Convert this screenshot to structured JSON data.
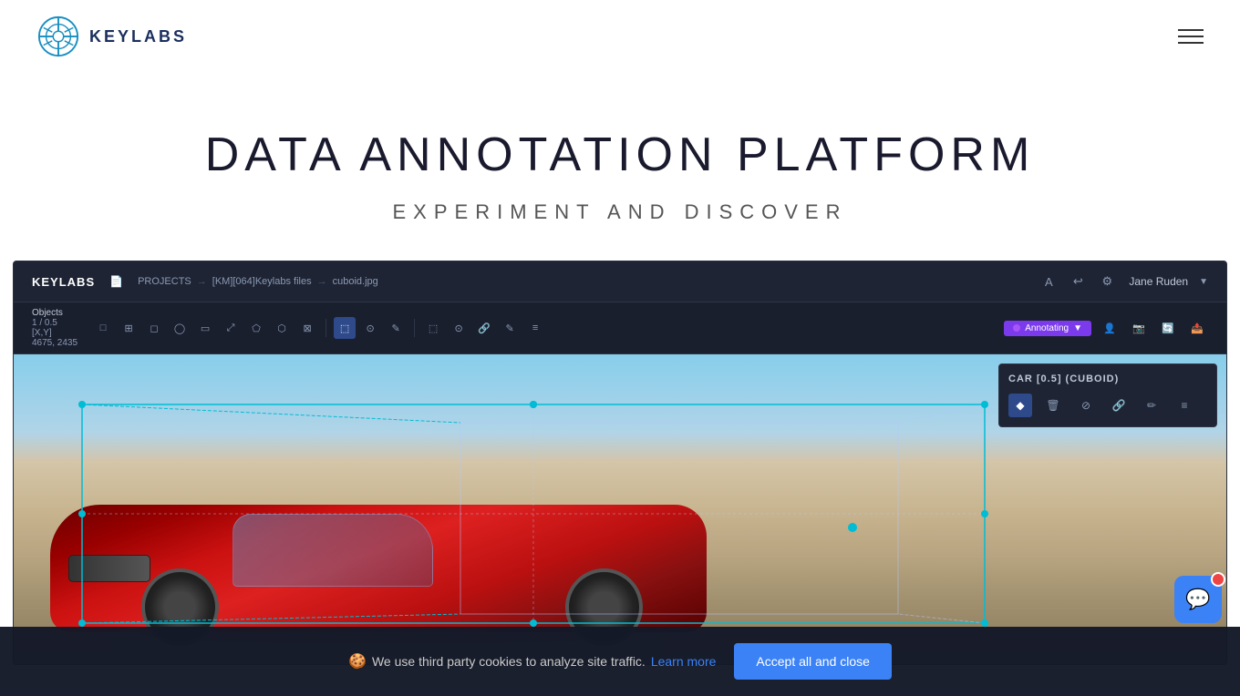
{
  "header": {
    "logo_text": "KEYLABS",
    "menu_aria": "Menu"
  },
  "hero": {
    "title": "DATA ANNOTATION PLATFORM",
    "subtitle": "EXPERIMENT AND DISCOVER"
  },
  "app_ui": {
    "logo": "KEYLABS",
    "breadcrumb": {
      "projects": "PROJECTS",
      "folder": "[KM][064]Keylabs files",
      "file": "cuboid.jpg"
    },
    "header_icons": [
      "A",
      "↩",
      "⚙"
    ],
    "user": "Jane Ruden",
    "objects_label": "Objects",
    "objects_value": "1 / 0.5",
    "coords_label": "[X,Y]",
    "coords_value": "4675, 2435",
    "annotating_label": "Annotating",
    "panel": {
      "title": "CAR [0.5] (CUBOID)",
      "icons": [
        "◆",
        "🗑",
        "⊘",
        "🔗",
        "✏",
        "≡"
      ]
    }
  },
  "cookie_banner": {
    "icon": "🍪",
    "text": "We use third party cookies to analyze site traffic.",
    "learn_more": "Learn more",
    "accept_button": "Accept all and close"
  },
  "toolbar_tools": [
    "□",
    "⊞",
    "↗",
    "◎",
    "⊡",
    "⤢",
    "⬠",
    "⬡",
    "⊠",
    "|",
    "⬚",
    "⊙",
    "✎",
    "|",
    "⬚",
    "⊙",
    "🔗",
    "✏",
    "≡"
  ],
  "toolbar_right_tools": [
    "👤",
    "📷",
    "🔄",
    "📤"
  ]
}
